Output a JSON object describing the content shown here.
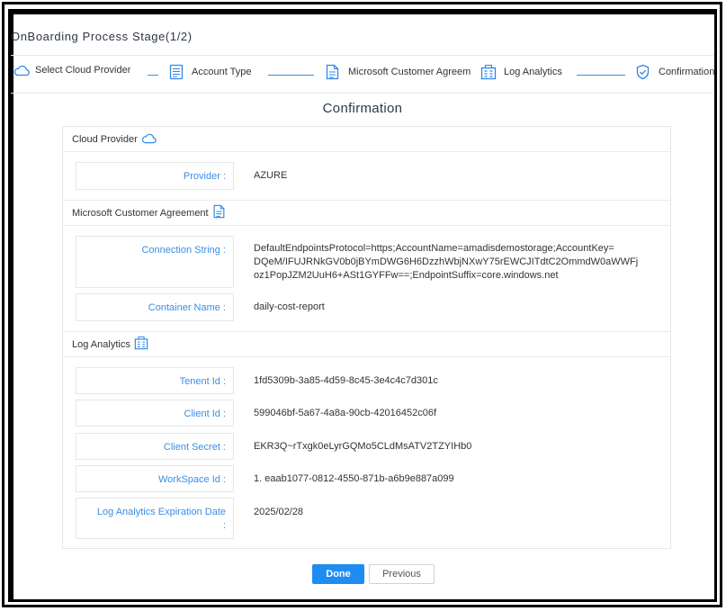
{
  "dialog": {
    "title": "OnBoarding Process Stage(1/2)"
  },
  "stepper": {
    "steps": [
      {
        "label": "Select Cloud Provider",
        "icon": "cloud-icon"
      },
      {
        "label": "Account Type",
        "icon": "document-list-icon"
      },
      {
        "label": "Microsoft Customer Agreement",
        "icon": "document-icon"
      },
      {
        "label": "Log Analytics",
        "icon": "analytics-icon"
      },
      {
        "label": "Confirmation",
        "icon": "shield-check-icon"
      }
    ]
  },
  "page": {
    "heading": "Confirmation"
  },
  "sections": {
    "cloud_provider": {
      "title": "Cloud Provider",
      "icon": "cloud-icon",
      "rows": [
        {
          "label": "Provider :",
          "value": "AZURE"
        }
      ]
    },
    "mca": {
      "title": "Microsoft Customer Agreement",
      "icon": "document-icon",
      "rows": [
        {
          "label": "Connection String :",
          "value_lines": [
            "DefaultEndpointsProtocol=https;AccountName=amadisdemostorage;AccountKey=",
            "DQeM/IFUJRNkGV0b0jBYmDWG6H6DzzhWbjNXwY75rEWCJITdtC2OmmdW0aWWFj",
            "oz1PopJZM2UuH6+ASt1GYFFw==;EndpointSuffix=core.windows.net"
          ]
        },
        {
          "label": "Container Name :",
          "value": "daily-cost-report"
        }
      ]
    },
    "log_analytics": {
      "title": "Log Analytics",
      "icon": "analytics-icon",
      "rows": [
        {
          "label": "Tenent Id :",
          "value": "1fd5309b-3a85-4d59-8c45-3e4c4c7d301c"
        },
        {
          "label": "Client Id :",
          "value": "599046bf-5a67-4a8a-90cb-42016452c06f"
        },
        {
          "label": "Client Secret :",
          "value": "EKR3Q~rTxgk0eLyrGQMo5CLdMsATV2TZYIHb0"
        },
        {
          "label": "WorkSpace Id :",
          "value": "1. eaab1077-0812-4550-871b-a6b9e887a099"
        },
        {
          "label_line1": "Log Analytics Expiration Date",
          "label_line2": ":",
          "value": "2025/02/28"
        }
      ]
    }
  },
  "buttons": {
    "done": "Done",
    "previous": "Previous"
  },
  "colors": {
    "accent": "#1f8cf2",
    "label_blue": "#3a8ee6",
    "border": "#e5e7ea"
  }
}
